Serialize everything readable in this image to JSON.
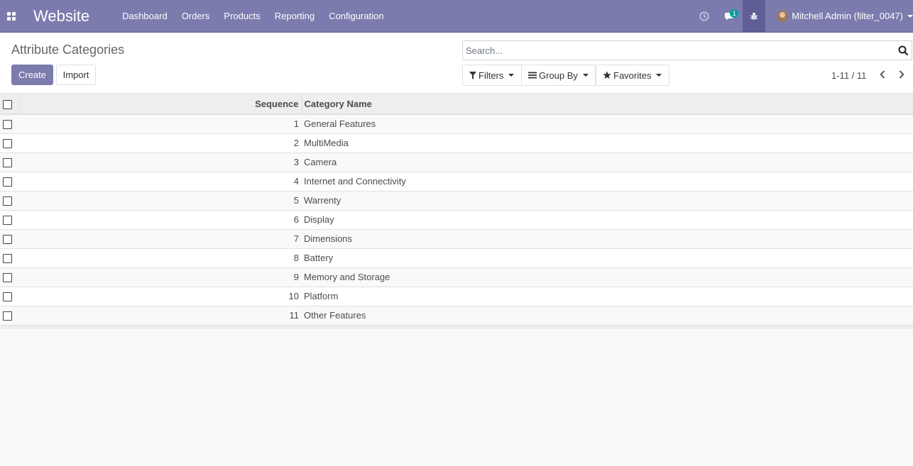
{
  "navbar": {
    "brand": "Website",
    "menu": [
      "Dashboard",
      "Orders",
      "Products",
      "Reporting",
      "Configuration"
    ],
    "messages_badge": "1",
    "user": "Mitchell Admin (filter_0047)"
  },
  "control_panel": {
    "title": "Attribute Categories",
    "create_label": "Create",
    "import_label": "Import",
    "search_placeholder": "Search...",
    "filters_label": "Filters",
    "groupby_label": "Group By",
    "favorites_label": "Favorites",
    "pager": "1-11 / 11"
  },
  "table": {
    "columns": {
      "sequence": "Sequence",
      "name": "Category Name"
    },
    "rows": [
      {
        "sequence": "1",
        "name": "General Features"
      },
      {
        "sequence": "2",
        "name": "MultiMedia"
      },
      {
        "sequence": "3",
        "name": "Camera"
      },
      {
        "sequence": "4",
        "name": "Internet and Connectivity"
      },
      {
        "sequence": "5",
        "name": "Warrenty"
      },
      {
        "sequence": "6",
        "name": "Display"
      },
      {
        "sequence": "7",
        "name": "Dimensions"
      },
      {
        "sequence": "8",
        "name": "Battery"
      },
      {
        "sequence": "9",
        "name": "Memory and Storage"
      },
      {
        "sequence": "10",
        "name": "Platform"
      },
      {
        "sequence": "11",
        "name": "Other Features"
      }
    ]
  },
  "colors": {
    "navbar": "#7c7bad",
    "primary_button": "#7c7bad",
    "badge": "#00a09d"
  },
  "icons": {
    "apps": "apps-grid-icon",
    "activity": "clock-icon",
    "messages": "chat-icon",
    "debug": "bug-icon",
    "search": "search-icon",
    "filters": "filter-icon",
    "groupby": "bars-icon",
    "favorites": "star-icon",
    "pager_prev": "chevron-left-icon",
    "pager_next": "chevron-right-icon"
  }
}
